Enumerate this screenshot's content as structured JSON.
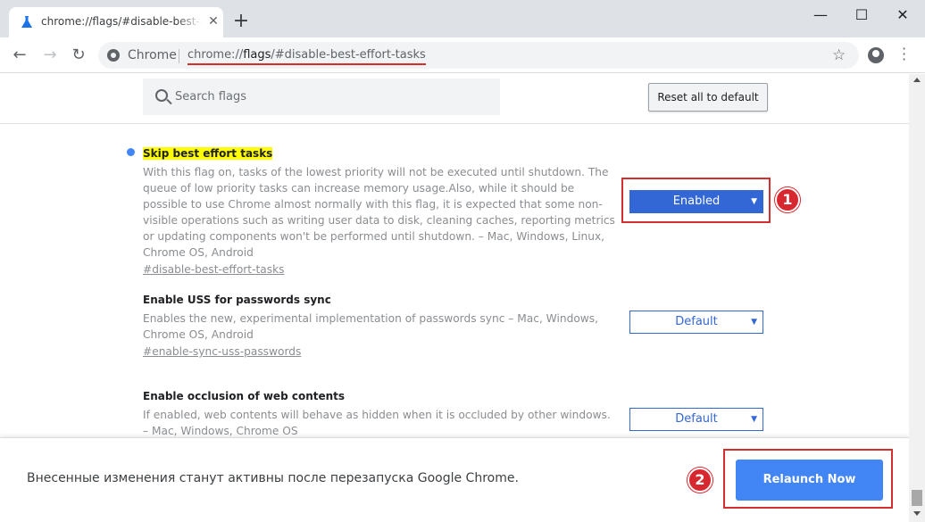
{
  "tab": {
    "title": "chrome://flags/#disable-best-effort-tasks",
    "close_icon": "close-icon",
    "new_tab_icon": "plus-icon"
  },
  "window": {
    "minimize": "—",
    "maximize": "☐",
    "close": "✕"
  },
  "toolbar": {
    "back": "←",
    "forward": "→",
    "reload": "↻",
    "chip_label": "Chrome",
    "url_prefix": "chrome://",
    "url_host": "flags",
    "url_rest": "/#disable-best-effort-tasks",
    "star": "☆"
  },
  "flags_page": {
    "search_placeholder": "Search flags",
    "reset_label": "Reset all to default",
    "flags": [
      {
        "title": "Skip best effort tasks",
        "description": "With this flag on, tasks of the lowest priority will not be executed until shutdown. The queue of low priority tasks can increase memory usage.Also, while it should be possible to use Chrome almost normally with this flag, it is expected that some non-visible operations such as writing user data to disk, cleaning caches, reporting metrics or updating components won't be performed until shutdown. – Mac, Windows, Linux, Chrome OS, Android",
        "link": "#disable-best-effort-tasks",
        "value": "Enabled",
        "modified": true
      },
      {
        "title": "Enable USS for passwords sync",
        "description": "Enables the new, experimental implementation of passwords sync – Mac, Windows, Chrome OS, Android",
        "link": "#enable-sync-uss-passwords",
        "value": "Default",
        "modified": false
      },
      {
        "title": "Enable occlusion of web contents",
        "description": "If enabled, web contents will behave as hidden when it is occluded by other windows. – Mac, Windows, Chrome OS",
        "link": "",
        "value": "Default",
        "modified": false
      }
    ]
  },
  "relaunch": {
    "message": "Внесенные изменения станут активны после перезапуска Google Chrome.",
    "button": "Relaunch Now"
  },
  "annotations": {
    "badge_1": "1",
    "badge_2": "2"
  },
  "colors": {
    "accent": "#3367d6",
    "relaunch": "#4285f4",
    "annotation": "#d32f2f",
    "highlight": "#ffff00"
  }
}
